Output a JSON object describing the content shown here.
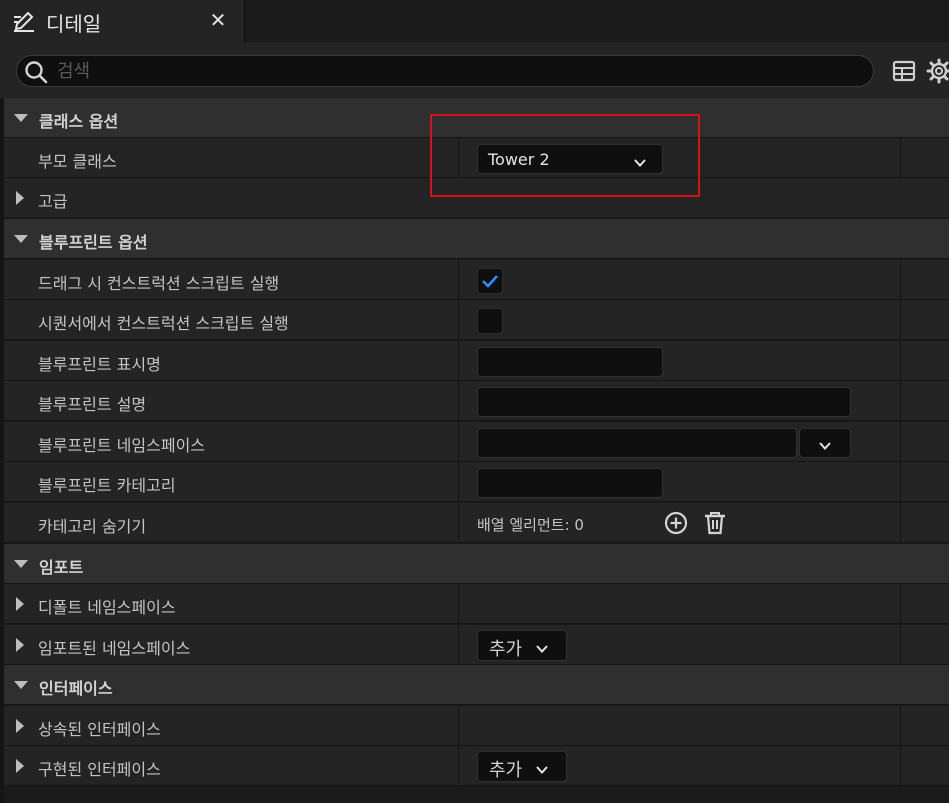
{
  "tab": {
    "title": "디테일",
    "close": "✕"
  },
  "search": {
    "placeholder": "검색"
  },
  "sections": {
    "class_options": {
      "title": "클래스 옵션",
      "parent_class_label": "부모 클래스",
      "parent_class_value": "Tower 2",
      "advanced_label": "고급"
    },
    "blueprint_options": {
      "title": "블루프린트 옵션",
      "run_construction_on_drag_label": "드래그 시 컨스트럭션 스크립트 실행",
      "run_construction_on_drag_checked": true,
      "run_construction_in_sequencer_label": "시퀀서에서 컨스트럭션 스크립트 실행",
      "run_construction_in_sequencer_checked": false,
      "display_name_label": "블루프린트 표시명",
      "display_name_value": "",
      "description_label": "블루프린트 설명",
      "description_value": "",
      "namespace_label": "블루프린트 네임스페이스",
      "namespace_value": "",
      "category_label": "블루프린트 카테고리",
      "category_value": "",
      "hide_categories_label": "카테고리 숨기기",
      "hide_categories_value": "배열 엘리먼트: 0"
    },
    "imports": {
      "title": "임포트",
      "default_namespaces_label": "디폴트 네임스페이스",
      "imported_namespaces_label": "임포트된 네임스페이스",
      "add_label": "추가"
    },
    "interfaces": {
      "title": "인터페이스",
      "inherited_label": "상속된 인터페이스",
      "implemented_label": "구현된 인터페이스",
      "add_label": "추가"
    }
  },
  "colors": {
    "highlight_box": "#d8121b",
    "checkbox_accent": "#2f8cff",
    "panel_bg": "#242424"
  },
  "icons": [
    "edit-icon",
    "close-icon",
    "search-icon",
    "table-icon",
    "gear-icon",
    "chevron-down-icon",
    "checkmark-icon",
    "plus-circle-icon",
    "trash-icon"
  ]
}
